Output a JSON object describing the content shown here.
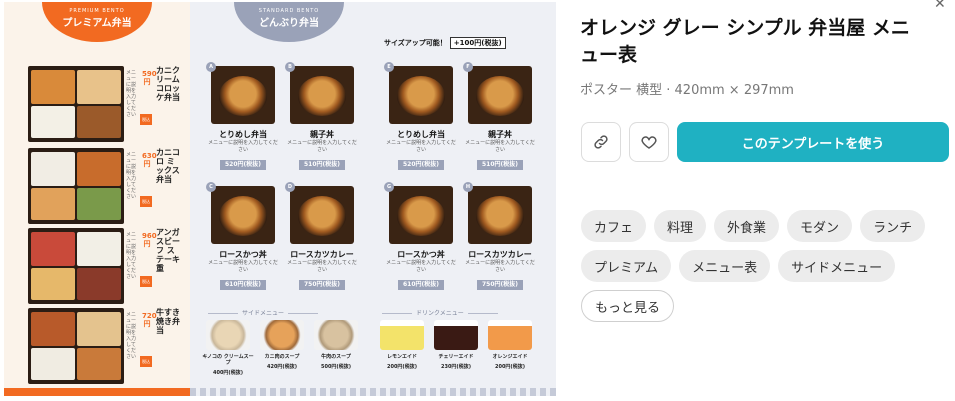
{
  "template": {
    "title": "オレンジ グレー シンプル 弁当屋 メニュー表",
    "meta": "ポスター 横型 · 420mm × 297mm",
    "use_button": "このテンプレートを使う",
    "tags": [
      "カフェ",
      "料理",
      "外食業",
      "モダン",
      "ランチ",
      "プレミアム",
      "メニュー表",
      "サイドメニュー"
    ],
    "more_label": "もっと見る"
  },
  "poster": {
    "premium": {
      "sub": "PREMIUM BENTO",
      "title": "プレミアム弁当",
      "items": [
        {
          "name": "カニクリーム コロッケ弁当",
          "price": "590円",
          "desc": "メニューに説明を入力してください",
          "tag": "税込"
        },
        {
          "name": "カニコロ ミックス弁当",
          "price": "630円",
          "desc": "メニューに説明を入力してください",
          "tag": "税込"
        },
        {
          "name": "アンガスビーフ ステーキ重",
          "price": "960円",
          "desc": "メニューに説明を入力してください",
          "tag": "税込"
        },
        {
          "name": "牛すき 焼き弁当",
          "price": "720円",
          "desc": "メニューに説明を入力してください",
          "tag": "税込"
        }
      ]
    },
    "standard": {
      "sub": "STANDARD BENTO",
      "title": "どんぶり弁当",
      "sizeup_text": "サイズアップ可能！",
      "sizeup_price": "+100円(税抜)",
      "items": [
        {
          "letter": "A",
          "name": "とりめし弁当",
          "desc": "メニューに説明を入力してください",
          "price": "520円(税抜)"
        },
        {
          "letter": "B",
          "name": "親子丼",
          "desc": "メニューに説明を入力してください",
          "price": "510円(税抜)"
        },
        {
          "letter": "E",
          "name": "とりめし弁当",
          "desc": "メニューに説明を入力してください",
          "price": "520円(税抜)"
        },
        {
          "letter": "F",
          "name": "親子丼",
          "desc": "メニューに説明を入力してください",
          "price": "510円(税抜)"
        },
        {
          "letter": "C",
          "name": "ロースかつ丼",
          "desc": "メニューに説明を入力してください",
          "price": "610円(税抜)"
        },
        {
          "letter": "D",
          "name": "ロースカツカレー",
          "desc": "メニューに説明を入力してください",
          "price": "750円(税抜)"
        },
        {
          "letter": "G",
          "name": "ロースかつ丼",
          "desc": "メニューに説明を入力してください",
          "price": "610円(税抜)"
        },
        {
          "letter": "H",
          "name": "ロースカツカレー",
          "desc": "メニューに説明を入力してください",
          "price": "750円(税抜)"
        }
      ]
    },
    "side": {
      "title": "サイドメニュー",
      "items": [
        {
          "name": "キノコの クリームスープ",
          "price": "400円(税抜)"
        },
        {
          "name": "カニ肉のスープ",
          "price": "420円(税抜)"
        },
        {
          "name": "牛肉のスープ",
          "price": "500円(税抜)"
        }
      ]
    },
    "drink": {
      "title": "ドリンクメニュー",
      "items": [
        {
          "name": "レモンエイド",
          "price": "200円(税抜)"
        },
        {
          "name": "チェリーエイド",
          "price": "230円(税抜)"
        },
        {
          "name": "オレンジエイド",
          "price": "200円(税抜)"
        }
      ]
    }
  },
  "icons": {
    "link": "link-icon",
    "favorite": "heart-icon",
    "close": "close-icon"
  },
  "colors": {
    "accent": "#1fb1c2",
    "orange": "#f26a21",
    "gray": "#9aa2b8"
  }
}
